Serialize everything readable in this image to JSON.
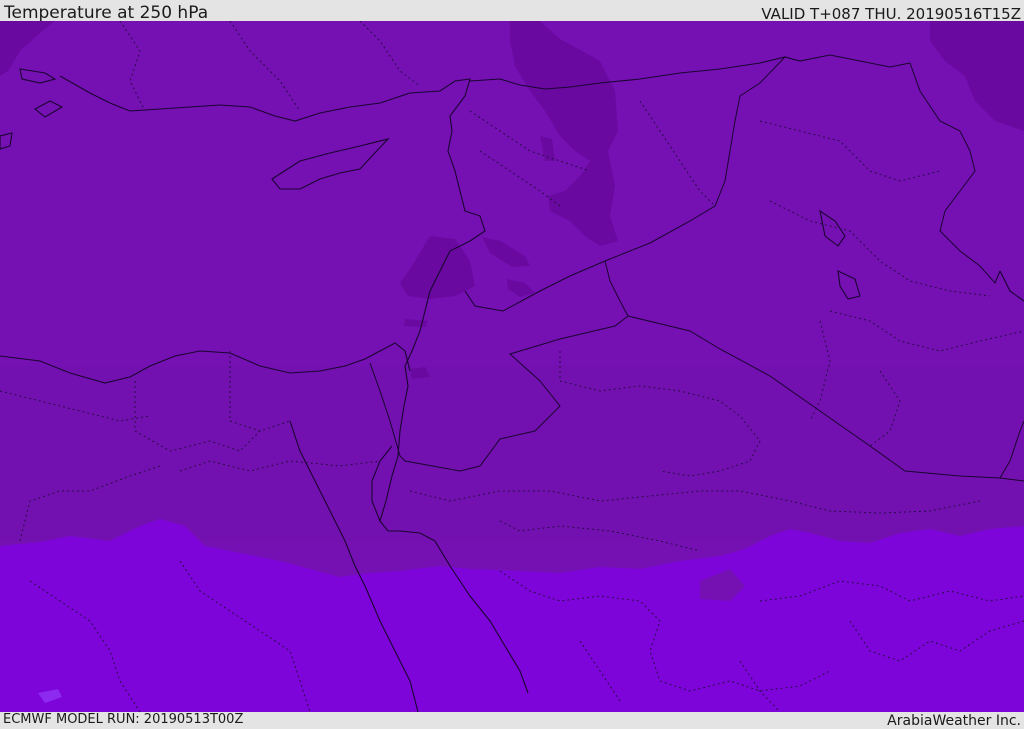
{
  "header": {
    "title": "Temperature at 250 hPa",
    "valid": "VALID T+087 THU. 20190516T15Z"
  },
  "footer": {
    "model_run": "ECMWF MODEL RUN: 20190513T00Z",
    "credit": "ArabiaWeather Inc."
  },
  "colors": {
    "main_field": "#7510b3",
    "darker_patch": "#6a09a0",
    "south_zone": "#7d05da",
    "light_spot": "#8c2af0",
    "coast_line": "#1a0430",
    "border_dotted": "#2a0c48",
    "background": "#e4e4e4"
  }
}
